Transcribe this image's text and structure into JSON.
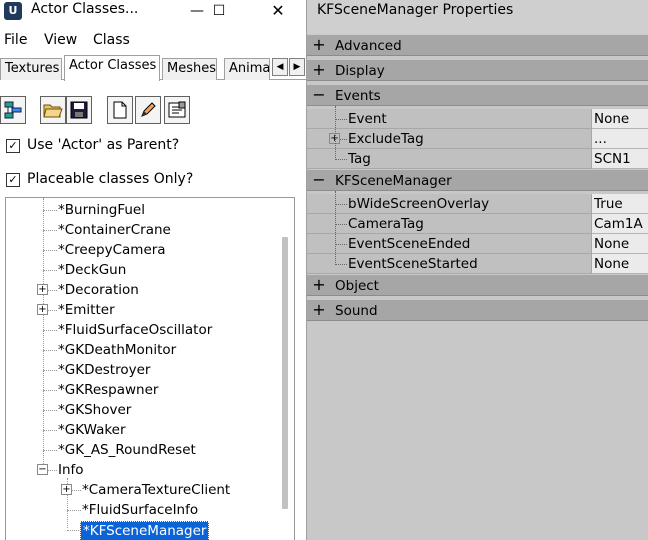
{
  "left_window": {
    "title": "Actor Classes...",
    "app_icon_glyph": "U",
    "controls": {
      "minimize": "—",
      "maximize": "☐",
      "close": "✕"
    },
    "menu": [
      "File",
      "View",
      "Class"
    ],
    "tabs": [
      "Textures",
      "Actor Classes",
      "Meshes",
      "Animat"
    ],
    "active_tab": "Actor Classes",
    "tab_arrows": {
      "left": "◀",
      "right": "▶"
    },
    "toolbar_icons": [
      "class-tree-icon",
      "open-folder-icon",
      "save-disk-icon",
      "new-document-icon",
      "pencil-icon",
      "properties-icon"
    ],
    "checkboxes": [
      {
        "label": "Use 'Actor' as Parent?",
        "checked": true,
        "mark": "✓"
      },
      {
        "label": "Placeable classes Only?",
        "checked": true,
        "mark": "✓"
      }
    ],
    "tree": [
      {
        "label": "*BurningFuel",
        "expander": ""
      },
      {
        "label": "*ContainerCrane",
        "expander": ""
      },
      {
        "label": "*CreepyCamera",
        "expander": ""
      },
      {
        "label": "*DeckGun",
        "expander": ""
      },
      {
        "label": "*Decoration",
        "expander": "+"
      },
      {
        "label": "*Emitter",
        "expander": "+"
      },
      {
        "label": "*FluidSurfaceOscillator",
        "expander": ""
      },
      {
        "label": "*GKDeathMonitor",
        "expander": ""
      },
      {
        "label": "*GKDestroyer",
        "expander": ""
      },
      {
        "label": "*GKRespawner",
        "expander": ""
      },
      {
        "label": "*GKShover",
        "expander": ""
      },
      {
        "label": "*GKWaker",
        "expander": ""
      },
      {
        "label": "*GK_AS_RoundReset",
        "expander": ""
      },
      {
        "label": "Info",
        "expander": "−"
      },
      {
        "label": "*CameraTextureClient",
        "expander": "+"
      },
      {
        "label": "*FluidSurfaceInfo",
        "expander": ""
      },
      {
        "label": "*KFSceneManager",
        "expander": "",
        "selected": true
      }
    ]
  },
  "right_window": {
    "title": "KFSceneManager Properties",
    "sections": [
      {
        "label": "Advanced",
        "sign": "+",
        "props": []
      },
      {
        "label": "Display",
        "sign": "+",
        "props": []
      },
      {
        "label": "Events",
        "sign": "−",
        "props": [
          {
            "name": "Event",
            "value": "None"
          },
          {
            "name": "ExcludeTag",
            "value": "...",
            "expander": "+"
          },
          {
            "name": "Tag",
            "value": "SCN1"
          }
        ]
      },
      {
        "label": "KFSceneManager",
        "sign": "−",
        "props": [
          {
            "name": "bWideScreenOverlay",
            "value": "True"
          },
          {
            "name": "CameraTag",
            "value": "Cam1A"
          },
          {
            "name": "EventSceneEnded",
            "value": "None"
          },
          {
            "name": "EventSceneStarted",
            "value": "None"
          }
        ]
      },
      {
        "label": "Object",
        "sign": "+",
        "props": []
      },
      {
        "label": "Sound",
        "sign": "+",
        "props": []
      }
    ]
  },
  "colors": {
    "selection": "#0a64d8",
    "category_bg": "#a6a6a6",
    "property_bg": "#c0c0c0",
    "value_bg": "#ebebeb"
  }
}
